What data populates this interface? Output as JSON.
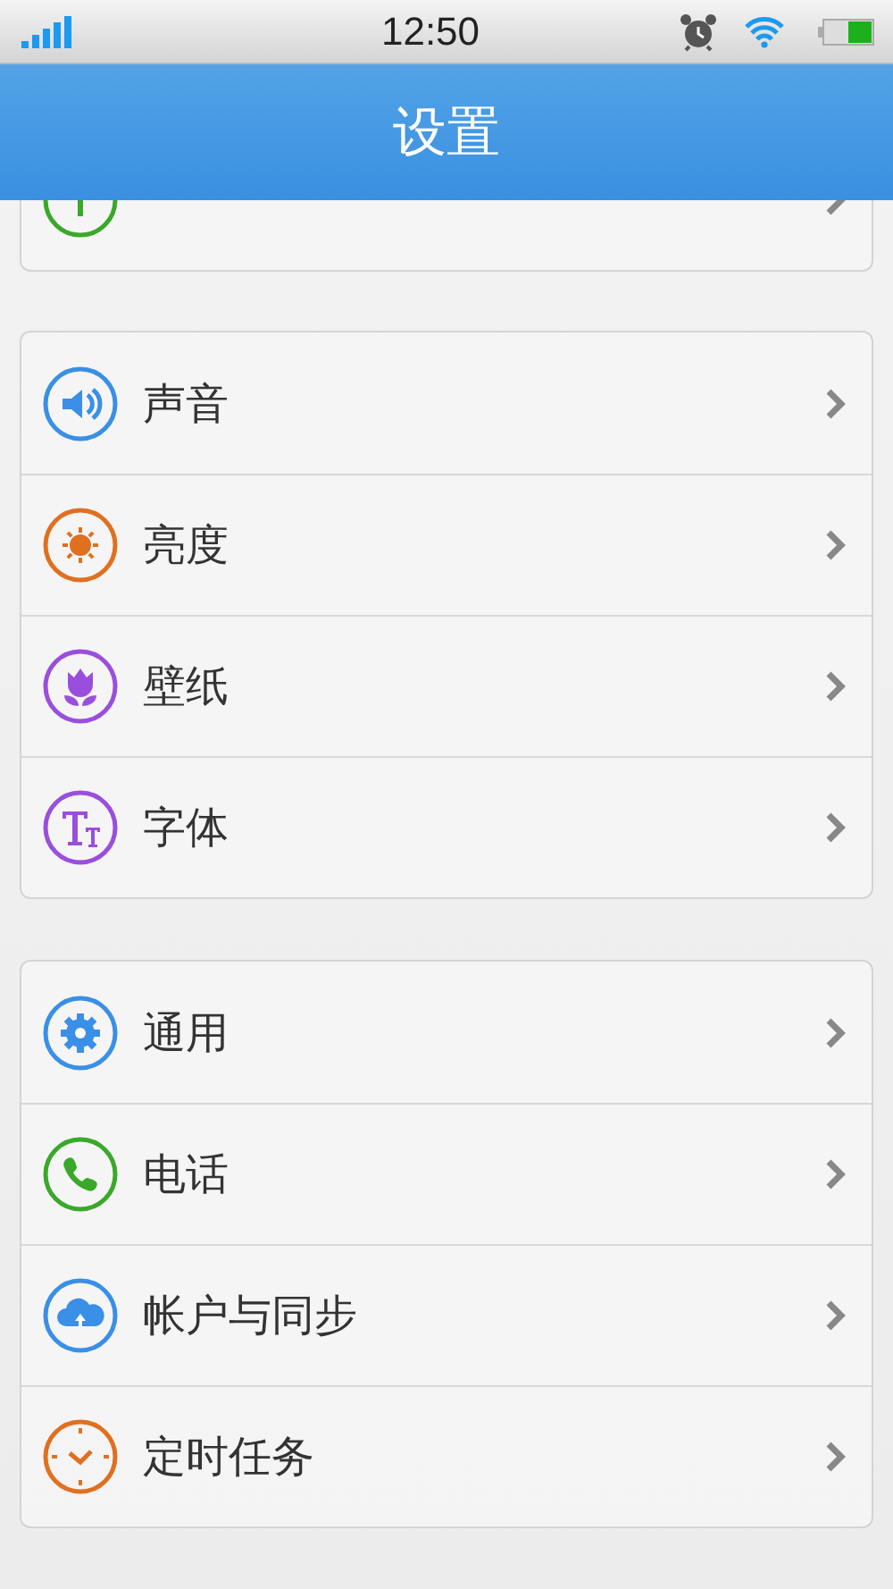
{
  "status_bar": {
    "time": "12:50"
  },
  "header": {
    "title": "设置"
  },
  "groups": [
    {
      "partial": true
    },
    {
      "partial": false,
      "items": [
        {
          "label": "声音"
        },
        {
          "label": "亮度"
        },
        {
          "label": "壁纸"
        },
        {
          "label": "字体"
        }
      ]
    },
    {
      "partial": false,
      "items": [
        {
          "label": "通用"
        },
        {
          "label": "电话"
        },
        {
          "label": "帐户与同步"
        },
        {
          "label": "定时任务"
        }
      ]
    }
  ]
}
